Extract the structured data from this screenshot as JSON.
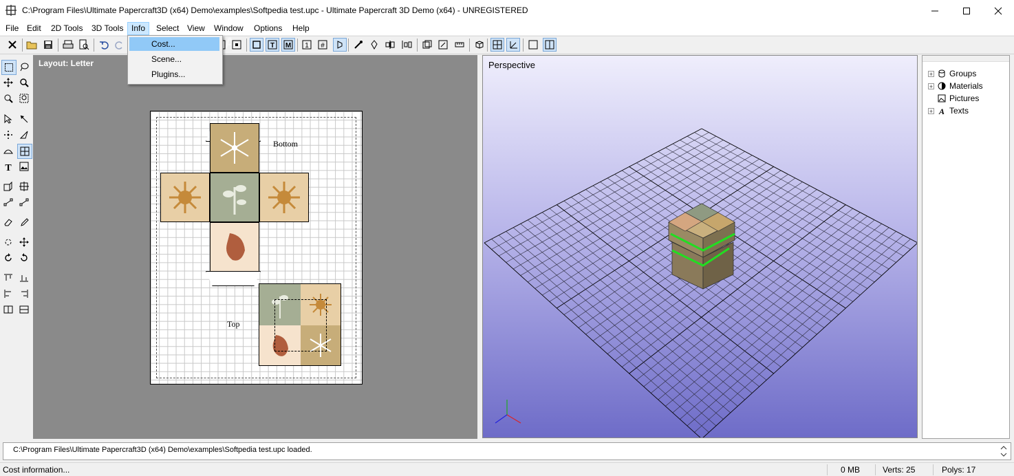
{
  "window": {
    "title": "C:\\Program Files\\Ultimate Papercraft3D (x64) Demo\\examples\\Softpedia test.upc - Ultimate Papercraft 3D Demo (x64) - UNREGISTERED"
  },
  "menu": {
    "items": [
      {
        "label": "File"
      },
      {
        "label": "Edit"
      },
      {
        "label": "2D Tools"
      },
      {
        "label": "3D Tools"
      },
      {
        "label": "Info"
      },
      {
        "label": "Select"
      },
      {
        "label": "View"
      },
      {
        "label": "Window"
      },
      {
        "label": "Options"
      },
      {
        "label": "Help"
      }
    ],
    "active": "Info",
    "dropdown": [
      {
        "label": "Cost..."
      },
      {
        "label": "Scene..."
      },
      {
        "label": "Plugins..."
      }
    ]
  },
  "toolbar": {
    "icons": [
      "close-icon",
      "open-folder-icon",
      "save-icon",
      "print-icon",
      "print-preview-icon",
      "undo-icon",
      "redo-icon"
    ]
  },
  "layout_view": {
    "label": "Layout: Letter",
    "face_labels": {
      "bottom": "Bottom",
      "top": "Top"
    }
  },
  "perspective_view": {
    "label": "Perspective"
  },
  "tree": {
    "items": [
      {
        "label": "Groups",
        "icon": "cylinder-icon",
        "expandable": true
      },
      {
        "label": "Materials",
        "icon": "sphere-icon",
        "expandable": true
      },
      {
        "label": "Pictures",
        "icon": "picture-icon",
        "expandable": false
      },
      {
        "label": "Texts",
        "icon": "text-icon",
        "expandable": true
      }
    ]
  },
  "log": {
    "message": "C:\\Program Files\\Ultimate Papercraft3D (x64) Demo\\examples\\Softpedia test.upc loaded."
  },
  "status": {
    "info": "Cost information...",
    "memory": "0 MB",
    "verts": "Verts: 25",
    "polys": "Polys: 17"
  },
  "colors": {
    "menu_active": "#cce8ff",
    "dropdown_hover": "#91c9f7",
    "layout_bg": "#8a8a8a",
    "perspective_top": "#efeefc",
    "perspective_bottom": "#6e6cc8",
    "selection_green": "#22dd22"
  }
}
